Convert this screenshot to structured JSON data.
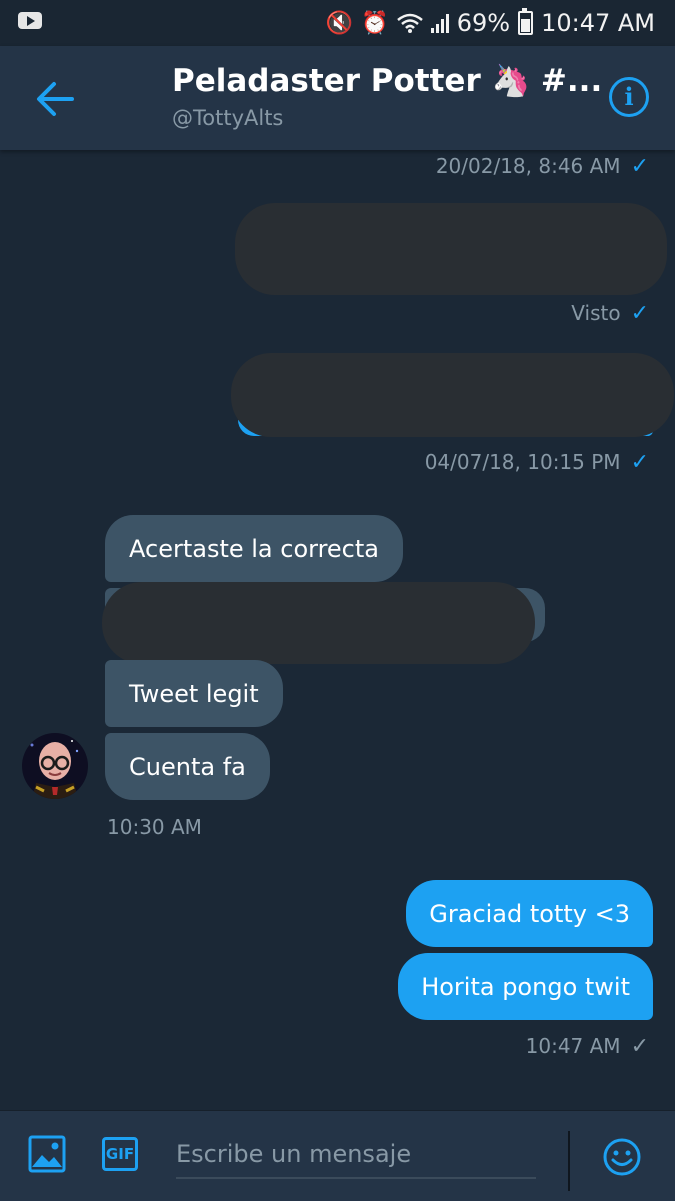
{
  "status_bar": {
    "battery": "69%",
    "time": "10:47 AM",
    "icons": [
      "youtube-app-icon",
      "mute-icon",
      "alarm-icon",
      "wifi-icon",
      "signal-icon",
      "battery-icon"
    ]
  },
  "header": {
    "title": "Peladaster Potter 🦄 #...",
    "handle": "@TottyAlts"
  },
  "messages": {
    "ts1": "20/02/18, 8:46 AM",
    "seen": "Visto",
    "ts2": "04/07/18, 10:15 PM",
    "received": [
      "Acertaste la correcta",
      "Tweet legit",
      "Cuenta fa"
    ],
    "ts3": "10:30 AM",
    "sent": [
      "Graciad totty <3",
      "Horita pongo twit"
    ],
    "ts4": "10:47 AM"
  },
  "composer": {
    "placeholder": "Escribe un mensaje",
    "gif_label": "GIF"
  },
  "colors": {
    "background": "#1b2836",
    "header": "#243447",
    "accent": "#1da1f2",
    "received_bubble": "#3d5466",
    "muted_text": "#8899a6",
    "redaction": "#292e33"
  }
}
